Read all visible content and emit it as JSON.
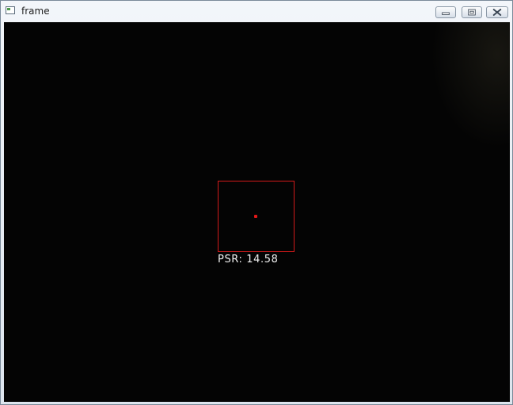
{
  "window": {
    "title": "frame",
    "controls": {
      "minimize_icon": "minimize-icon",
      "maximize_icon": "restore-icon",
      "close_icon": "close-icon"
    }
  },
  "video": {
    "background_color": "#040404",
    "tracker": {
      "box_color": "#d11a1a",
      "center_color": "#e01818"
    },
    "psr_label": "PSR: 14.58"
  }
}
